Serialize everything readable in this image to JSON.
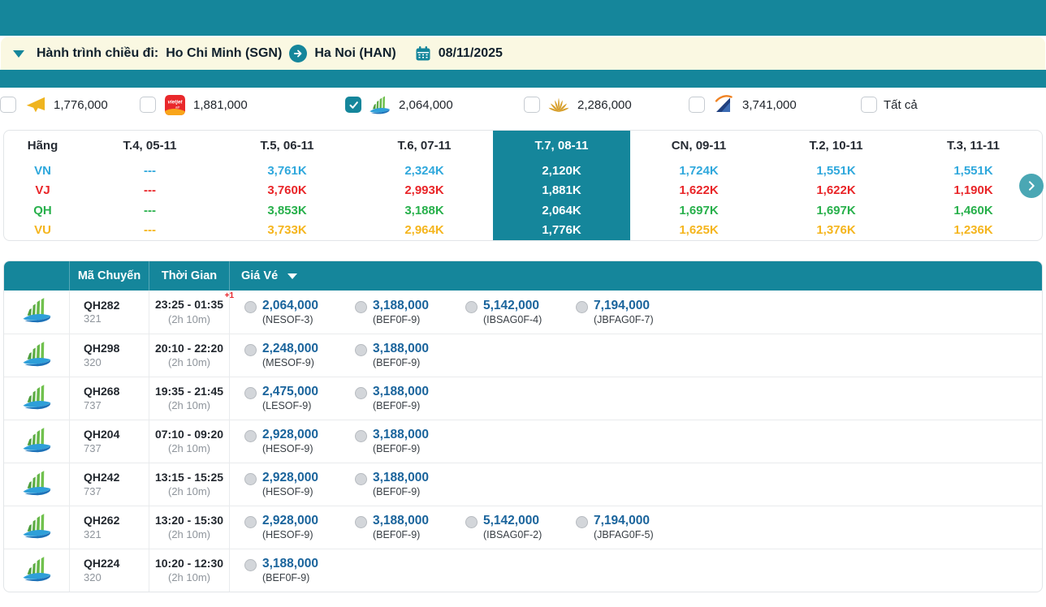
{
  "journey": {
    "label": "Hành trình chiều đi:",
    "origin": "Ho Chi Minh (SGN)",
    "destination": "Ha Noi (HAN)",
    "date": "08/11/2025"
  },
  "filters": {
    "items": [
      {
        "airline": "VU",
        "icon": "paper-plane-yellow",
        "price": "1,776,000",
        "checked": false
      },
      {
        "airline": "VJ",
        "icon": "vietjet-logo",
        "price": "1,881,000",
        "checked": false
      },
      {
        "airline": "QH",
        "icon": "bamboo-logo",
        "price": "2,064,000",
        "checked": true
      },
      {
        "airline": "VN",
        "icon": "gold-lotus",
        "price": "2,286,000",
        "checked": false
      },
      {
        "airline": "VU2",
        "icon": "vietravel-sail",
        "price": "3,741,000",
        "checked": false
      }
    ],
    "all_label": "Tất cả"
  },
  "matrix": {
    "columns": [
      "Hãng",
      "T.4, 05-11",
      "T.5, 06-11",
      "T.6, 07-11",
      "T.7, 08-11",
      "CN, 09-11",
      "T.2, 10-11",
      "T.3, 11-11"
    ],
    "selected_column": "T.7, 08-11",
    "colors": {
      "VN": "#2FA8DC",
      "VJ": "#E92528",
      "QH": "#27B04B",
      "VU": "#F5B51D",
      "accent_teal": "#15869B",
      "price_blue": "#1A649C"
    },
    "rows": [
      {
        "airline": "VN",
        "values": [
          "---",
          "3,761K",
          "2,324K",
          "2,120K",
          "1,724K",
          "1,551K",
          "1,551K"
        ]
      },
      {
        "airline": "VJ",
        "values": [
          "---",
          "3,760K",
          "2,993K",
          "1,881K",
          "1,622K",
          "1,622K",
          "1,190K"
        ]
      },
      {
        "airline": "QH",
        "values": [
          "---",
          "3,853K",
          "3,188K",
          "2,064K",
          "1,697K",
          "1,697K",
          "1,460K"
        ]
      },
      {
        "airline": "VU",
        "values": [
          "---",
          "3,733K",
          "2,964K",
          "1,776K",
          "1,625K",
          "1,376K",
          "1,236K"
        ]
      }
    ]
  },
  "table": {
    "headers": {
      "code": "Mã Chuyến",
      "time": "Thời Gian",
      "price": "Giá Vé"
    },
    "rows": [
      {
        "code": "QH282",
        "aircraft": "321",
        "time": "23:25 - 01:35",
        "plus_day": "+1",
        "duration": "(2h 10m)",
        "fares": [
          {
            "price": "2,064,000",
            "fare_class": "(NESOF-3)"
          },
          {
            "price": "3,188,000",
            "fare_class": "(BEF0F-9)"
          },
          {
            "price": "5,142,000",
            "fare_class": "(IBSAG0F-4)"
          },
          {
            "price": "7,194,000",
            "fare_class": "(JBFAG0F-7)"
          }
        ]
      },
      {
        "code": "QH298",
        "aircraft": "320",
        "time": "20:10 - 22:20",
        "duration": "(2h 10m)",
        "fares": [
          {
            "price": "2,248,000",
            "fare_class": "(MESOF-9)"
          },
          {
            "price": "3,188,000",
            "fare_class": "(BEF0F-9)"
          }
        ]
      },
      {
        "code": "QH268",
        "aircraft": "737",
        "time": "19:35 - 21:45",
        "duration": "(2h 10m)",
        "fares": [
          {
            "price": "2,475,000",
            "fare_class": "(LESOF-9)"
          },
          {
            "price": "3,188,000",
            "fare_class": "(BEF0F-9)"
          }
        ]
      },
      {
        "code": "QH204",
        "aircraft": "737",
        "time": "07:10 - 09:20",
        "duration": "(2h 10m)",
        "fares": [
          {
            "price": "2,928,000",
            "fare_class": "(HESOF-9)"
          },
          {
            "price": "3,188,000",
            "fare_class": "(BEF0F-9)"
          }
        ]
      },
      {
        "code": "QH242",
        "aircraft": "737",
        "time": "13:15 - 15:25",
        "duration": "(2h 10m)",
        "fares": [
          {
            "price": "2,928,000",
            "fare_class": "(HESOF-9)"
          },
          {
            "price": "3,188,000",
            "fare_class": "(BEF0F-9)"
          }
        ]
      },
      {
        "code": "QH262",
        "aircraft": "321",
        "time": "13:20 - 15:30",
        "duration": "(2h 10m)",
        "fares": [
          {
            "price": "2,928,000",
            "fare_class": "(HESOF-9)"
          },
          {
            "price": "3,188,000",
            "fare_class": "(BEF0F-9)"
          },
          {
            "price": "5,142,000",
            "fare_class": "(IBSAG0F-2)"
          },
          {
            "price": "7,194,000",
            "fare_class": "(JBFAG0F-5)"
          }
        ]
      },
      {
        "code": "QH224",
        "aircraft": "320",
        "time": "10:20 - 12:30",
        "duration": "(2h 10m)",
        "fares": [
          {
            "price": "3,188,000",
            "fare_class": "(BEF0F-9)"
          }
        ]
      }
    ]
  }
}
